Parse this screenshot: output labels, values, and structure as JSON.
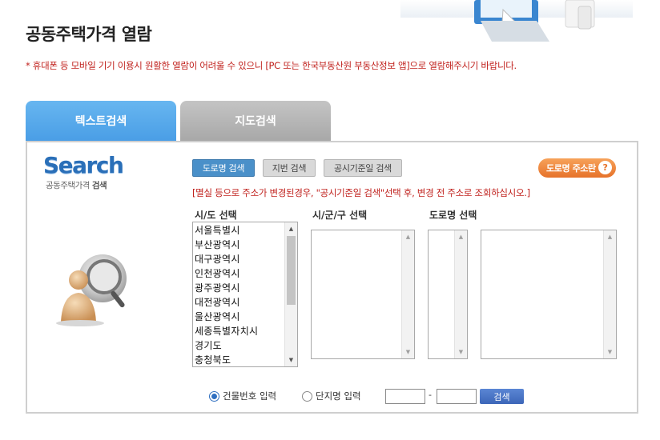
{
  "page": {
    "title": "공동주택가격 열람",
    "notice": "* 휴대폰 등 모바일 기기 이용시 원활한 열람이 어려울 수 있으니 [PC 또는 한국부동산원 부동산정보 앱]으로 열람해주시기 바랍니다."
  },
  "tabs": [
    {
      "label": "텍스트검색",
      "active": true
    },
    {
      "label": "지도검색",
      "active": false
    }
  ],
  "logo": {
    "word": "Search",
    "sub_prefix": "공동주택가격",
    "sub_bold": "검색"
  },
  "search_mode": {
    "road_label": "도로명 검색",
    "lot_label": "지번 검색",
    "date_label": "공시기준일 검색",
    "addr_button_label": "도로명 주소란",
    "addr_help": "?"
  },
  "hint": "[멸실 등으로 주소가 변경된경우, \"공시기준일 검색\"선택 후, 변경 전 주소로 조회하십시오.]",
  "columns": {
    "sido": "시/도 선택",
    "sigungu": "시/군/구 선택",
    "road": "도로명 선택"
  },
  "sido_options": [
    "서울특별시",
    "부산광역시",
    "대구광역시",
    "인천광역시",
    "광주광역시",
    "대전광역시",
    "울산광역시",
    "세종특별자치시",
    "경기도",
    "충청북도"
  ],
  "input_mode": {
    "building_label": "건물번호 입력",
    "complex_label": "단지명 입력",
    "selected": "building",
    "from_value": "",
    "to_value": "",
    "dash": "-",
    "search_label": "검색"
  },
  "colors": {
    "accent": "#4a9ee6",
    "notice_red": "#c0211d",
    "orange": "#e6722a"
  }
}
